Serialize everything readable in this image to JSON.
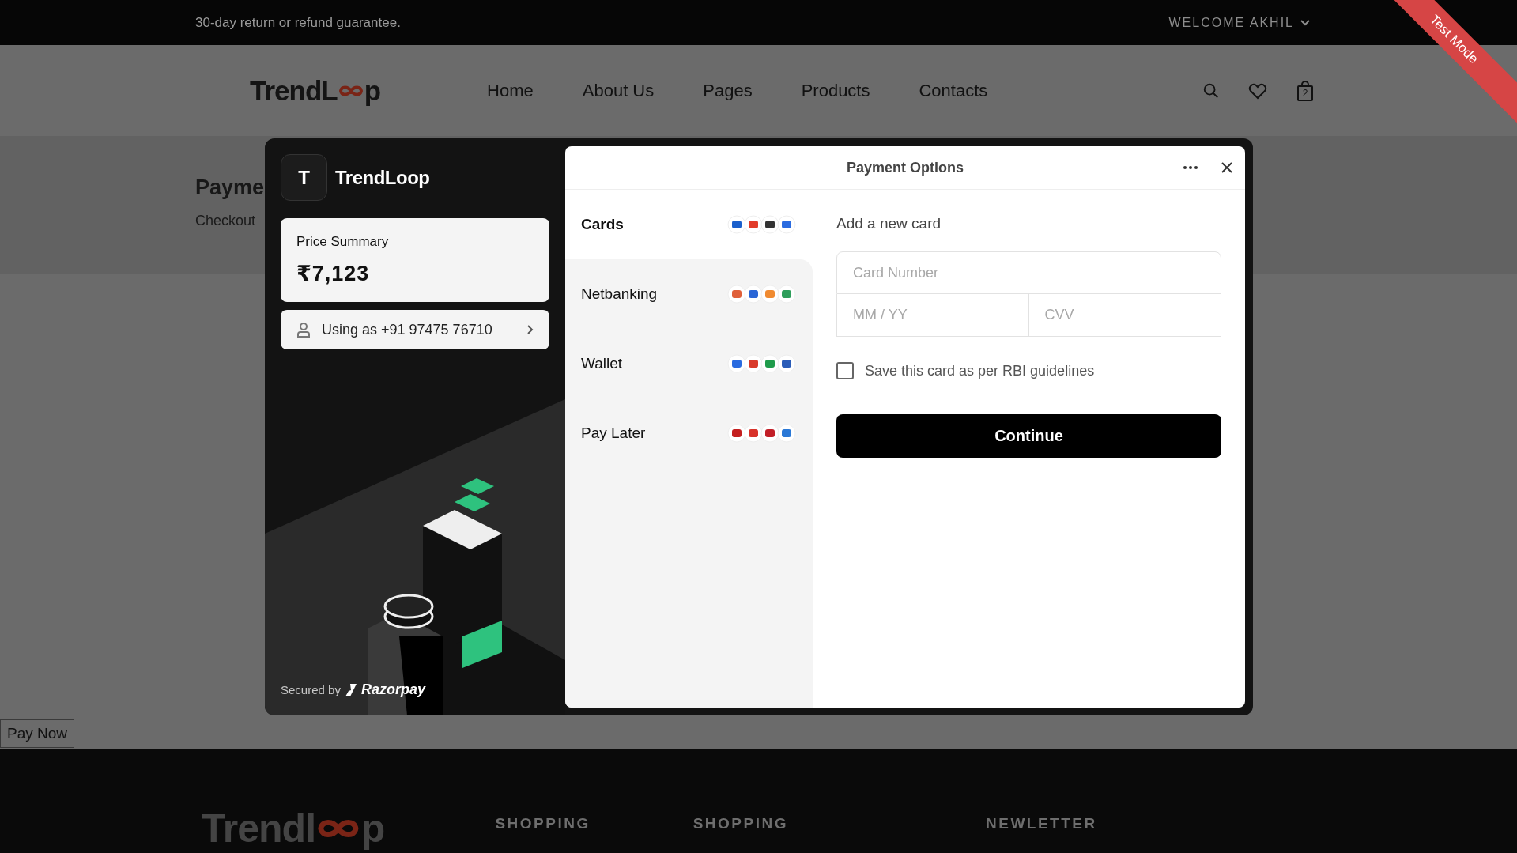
{
  "top_bar": {
    "notice": "30-day return or refund guarantee.",
    "account": "WELCOME AKHIL"
  },
  "ribbon": "Test Mode",
  "nav": {
    "logo": {
      "start": "TrendL",
      "end": "p"
    },
    "links": [
      {
        "label": "Home"
      },
      {
        "label": "About Us"
      },
      {
        "label": "Pages"
      },
      {
        "label": "Products"
      },
      {
        "label": "Contacts"
      }
    ],
    "cart_count": "2"
  },
  "page": {
    "title": "Payme",
    "breadcrumb": "Checkout",
    "pay_button": "Pay Now"
  },
  "checkout": {
    "merchant_initial": "T",
    "merchant_name": "TrendLoop",
    "price_label": "Price Summary",
    "price": "₹7,123",
    "contact": "Using as +91 97475 76710",
    "secured_by": "Secured by",
    "provider": "Razorpay",
    "title": "Payment Options",
    "methods": [
      {
        "label": "Cards",
        "selected": true
      },
      {
        "label": "Netbanking",
        "selected": false
      },
      {
        "label": "Wallet",
        "selected": false
      },
      {
        "label": "Pay Later",
        "selected": false
      }
    ],
    "form": {
      "heading": "Add a new card",
      "card_number": {
        "placeholder": "Card Number"
      },
      "expiry": {
        "placeholder": "MM / YY"
      },
      "cvv": {
        "placeholder": "CVV"
      },
      "save_card": {
        "label": "Save this card as per RBI guidelines",
        "checked": false
      },
      "submit": "Continue"
    }
  },
  "footer": {
    "logo": {
      "start": "Trendl",
      "end": "p"
    },
    "headings": [
      "SHOPPING",
      "SHOPPING",
      "NEWLETTER"
    ]
  }
}
